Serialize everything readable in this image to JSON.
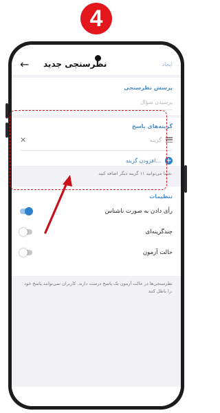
{
  "step_badge": "4",
  "topbar": {
    "back_icon": "arrow-left-icon",
    "title": "نظرسنجی جدید",
    "create_label": "ایجاد"
  },
  "question": {
    "section_label": "پرسش نظرسنجی",
    "placeholder": "پرسیدن سؤال"
  },
  "options": {
    "section_label": "گزینه‌های پاسخ",
    "items": [
      {
        "placeholder": "گزینه"
      }
    ],
    "add_label": "افزودن گزینه...",
    "hint": "شما می‌توانید ۱۱ گزینه دیگر اضافه کنید."
  },
  "settings": {
    "section_label": "تنظیمات",
    "items": [
      {
        "label": "رأی دادن به صورت ناشناس",
        "on": true
      },
      {
        "label": "چندگزینه‌ای",
        "on": false
      },
      {
        "label": "حالت آزمون",
        "on": false
      }
    ],
    "hint": "نظرسنجی‌ها در حالت آزمون یک پاسخ درست دارند. کاربران نمی‌توانند پاسخ خود را باطل کنند."
  },
  "colors": {
    "annotation": "#d11a1a",
    "accent": "#2f80c9",
    "badge": "#e3161c"
  }
}
